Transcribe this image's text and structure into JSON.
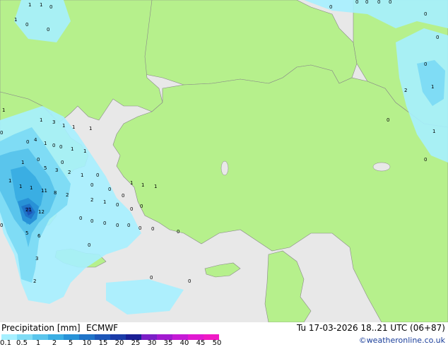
{
  "legend": {
    "title": "Precipitation [mm]",
    "model": "ECMWF",
    "valid_time": "Tu 17-03-2026 18..21 UTC (06+87)",
    "credit": "©weatheronline.co.uk",
    "ticks": [
      "0.1",
      "0.5",
      "1",
      "2",
      "5",
      "10",
      "15",
      "20",
      "25",
      "30",
      "35",
      "40",
      "45",
      "50"
    ],
    "colors": [
      "#a6f0ff",
      "#7fdcf5",
      "#5ac5ec",
      "#3aaee3",
      "#2892d7",
      "#1f74c8",
      "#1c56b8",
      "#1a3ba8",
      "#1a1f95",
      "#7b1fc7",
      "#a21ad0",
      "#c51ad6",
      "#e019d2",
      "#f01ac5"
    ]
  },
  "map": {
    "land_color": "#b6f08c",
    "sea_color": "#e8e8e8",
    "precip_labels": [
      "1",
      "1",
      "0",
      "1",
      "0",
      "0",
      "0",
      "0",
      "0",
      "0",
      "0",
      "0",
      "0",
      "0",
      "0",
      "0",
      "2",
      "1",
      "1",
      "0",
      "1",
      "1",
      "3",
      "1",
      "1",
      "1",
      "1",
      "1",
      "0",
      "0",
      "0",
      "4",
      "1",
      "0",
      "1",
      "1",
      "1",
      "0",
      "5",
      "3",
      "2",
      "1",
      "0",
      "0",
      "1",
      "1",
      "1",
      "0",
      "1",
      "11",
      "8",
      "2",
      "0",
      "2",
      "1",
      "0",
      "21",
      "12",
      "0",
      "0",
      "0",
      "0",
      "0",
      "0",
      "0",
      "0",
      "0",
      "0",
      "0",
      "5",
      "6",
      "0",
      "3",
      "0",
      "0",
      "2"
    ]
  }
}
